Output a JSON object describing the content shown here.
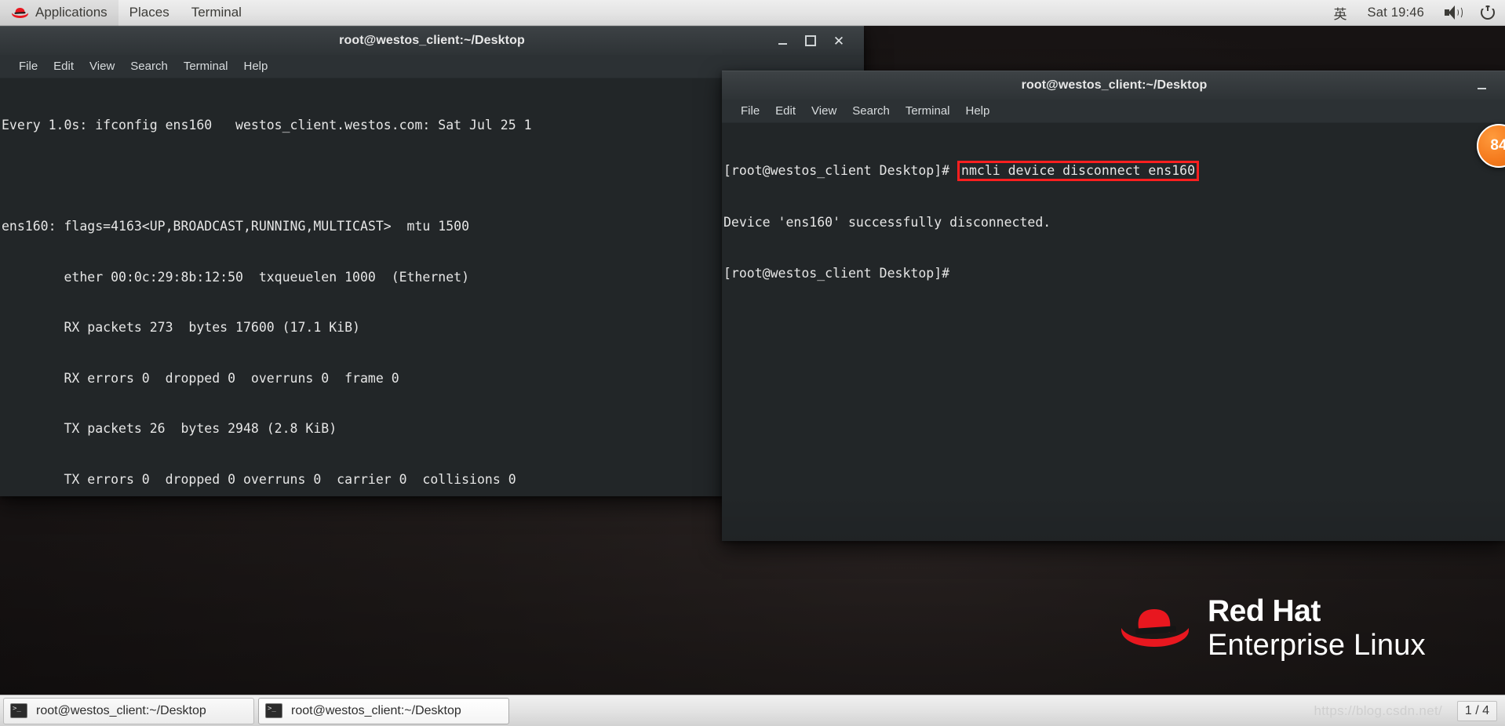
{
  "top_panel": {
    "logo_icon": "redhat-hat-icon",
    "menus": [
      {
        "label": "Applications"
      },
      {
        "label": "Places"
      },
      {
        "label": "Terminal"
      }
    ],
    "input_method": "英",
    "clock": "Sat 19:46",
    "volume_icon": "speaker-icon",
    "power_icon": "power-icon"
  },
  "window1": {
    "title": "root@westos_client:~/Desktop",
    "menus": [
      "File",
      "Edit",
      "View",
      "Search",
      "Terminal",
      "Help"
    ],
    "buttons": {
      "minimize": "_",
      "maximize": "□",
      "close": "✕"
    },
    "lines": [
      "Every 1.0s: ifconfig ens160   westos_client.westos.com: Sat Jul 25 1",
      "",
      "ens160: flags=4163<UP,BROADCAST,RUNNING,MULTICAST>  mtu 1500",
      "        ether 00:0c:29:8b:12:50  txqueuelen 1000  (Ethernet)",
      "        RX packets 273  bytes 17600 (17.1 KiB)",
      "        RX errors 0  dropped 0  overruns 0  frame 0",
      "        TX packets 26  bytes 2948 (2.8 KiB)",
      "        TX errors 0  dropped 0 overruns 0  carrier 0  collisions 0"
    ]
  },
  "window2": {
    "title": "root@westos_client:~/Desktop",
    "menus": [
      "File",
      "Edit",
      "View",
      "Search",
      "Terminal",
      "Help"
    ],
    "buttons": {
      "minimize": "_"
    },
    "prompt1": "[root@westos_client Desktop]# ",
    "highlighted_command": "nmcli device disconnect ens160",
    "output_line": "Device 'ens160' successfully disconnected.",
    "prompt2": "[root@westos_client Desktop]#",
    "highlight_color": "#fb1f1f"
  },
  "badge": {
    "text": "84"
  },
  "branding": {
    "logo_icon": "redhat-hat-icon",
    "line1": "Red Hat",
    "line2": "Enterprise Linux",
    "accent_color": "#e8171f"
  },
  "taskbar": {
    "tasks": [
      {
        "label": "root@westos_client:~/Desktop",
        "icon": "terminal-icon",
        "active": false
      },
      {
        "label": "root@westos_client:~/Desktop",
        "icon": "terminal-icon",
        "active": true
      }
    ],
    "watermark": "https://blog.csdn.net/",
    "workspace": "1 / 4"
  }
}
